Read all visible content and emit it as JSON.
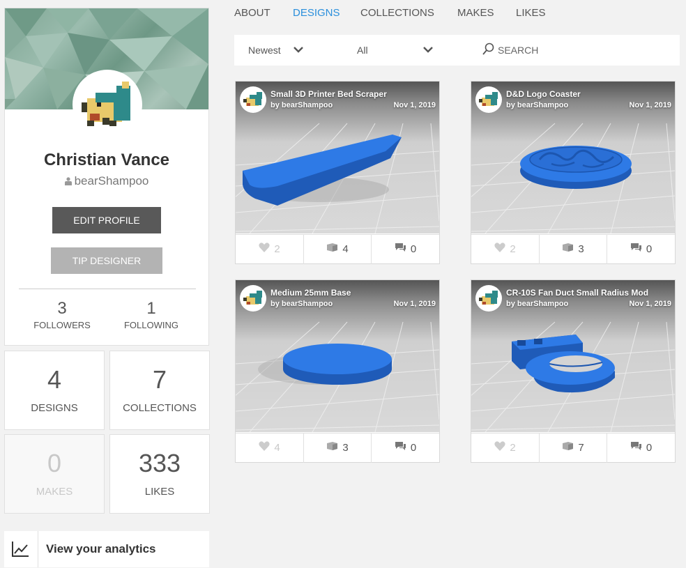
{
  "profile": {
    "name": "Christian Vance",
    "username": "bearShampoo",
    "edit_label": "EDIT PROFILE",
    "tip_label": "TIP DESIGNER",
    "followers": {
      "count": "3",
      "label": "FOLLOWERS"
    },
    "following": {
      "count": "1",
      "label": "FOLLOWING"
    }
  },
  "stats": {
    "designs": {
      "count": "4",
      "label": "DESIGNS"
    },
    "collections": {
      "count": "7",
      "label": "COLLECTIONS"
    },
    "makes": {
      "count": "0",
      "label": "MAKES"
    },
    "likes": {
      "count": "333",
      "label": "LIKES"
    }
  },
  "analytics": {
    "label": "View your analytics"
  },
  "tabs": [
    {
      "label": "ABOUT",
      "active": false
    },
    {
      "label": "DESIGNS",
      "active": true
    },
    {
      "label": "COLLECTIONS",
      "active": false
    },
    {
      "label": "MAKES",
      "active": false
    },
    {
      "label": "LIKES",
      "active": false
    }
  ],
  "filters": {
    "sort_value": "Newest",
    "filter_value": "All",
    "search_placeholder": "SEARCH"
  },
  "colors": {
    "accent": "#2a8fdc",
    "model_blue": "#2a6fd6",
    "edit_button": "#595959",
    "tip_button": "#b3b3b3"
  },
  "designs": [
    {
      "title": "Small 3D Printer Bed Scraper",
      "by": "by bearShampoo",
      "date": "Nov 1, 2019",
      "likes": "2",
      "makes": "4",
      "comments": "0",
      "model": "scraper"
    },
    {
      "title": "D&D Logo Coaster",
      "by": "by bearShampoo",
      "date": "Nov 1, 2019",
      "likes": "2",
      "makes": "3",
      "comments": "0",
      "model": "coaster"
    },
    {
      "title": "Medium 25mm Base",
      "by": "by bearShampoo",
      "date": "Nov 1, 2019",
      "likes": "4",
      "makes": "3",
      "comments": "0",
      "model": "base"
    },
    {
      "title": "CR-10S Fan Duct Small Radius Mod",
      "by": "by bearShampoo",
      "date": "Nov 1, 2019",
      "likes": "2",
      "makes": "7",
      "comments": "0",
      "model": "fan-duct"
    }
  ]
}
